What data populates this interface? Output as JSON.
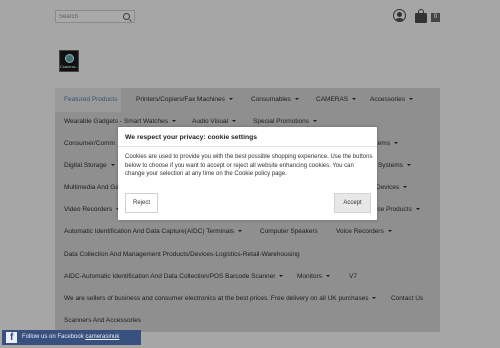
{
  "header": {
    "search_placeholder": "Search",
    "cart_count": "0"
  },
  "logo": {
    "text": "Cameras..."
  },
  "nav": {
    "items": [
      {
        "label": "Featured Products",
        "caret": false
      },
      {
        "label": "Printers/Copiers/Fax Machines",
        "caret": true
      },
      {
        "label": "Consumables",
        "caret": true
      },
      {
        "label": "CAMERAS",
        "caret": true
      },
      {
        "label": "Accessories",
        "caret": true
      },
      {
        "label": "Wearable Gadgets - Smart Watches",
        "caret": true
      },
      {
        "label": "Audio Visual",
        "caret": true
      },
      {
        "label": "Special Promotions",
        "caret": true
      },
      {
        "label": "Consumer/Comm",
        "caret": false
      },
      {
        "label": "tems",
        "caret": true
      },
      {
        "label": "Digital Storage",
        "caret": true
      },
      {
        "label": "r Systems",
        "caret": true
      },
      {
        "label": "Multimedia And Ga",
        "caret": false
      },
      {
        "label": "Devices",
        "caret": true
      },
      {
        "label": "Video Recorders",
        "caret": true
      },
      {
        "label": "rence Products",
        "caret": true
      },
      {
        "label": "Automatic Identification And Data Capture(AIDC) Terminals",
        "caret": true
      },
      {
        "label": "Computer Speakers",
        "caret": false
      },
      {
        "label": "Voice Recorders",
        "caret": true
      },
      {
        "label": "Data Collection And Management Products/Devices-Logistics-Retail-Warehousing",
        "caret": false
      },
      {
        "label": "AIDC-Automatic Identification And Data Collection/POS Barcode Scanner",
        "caret": true
      },
      {
        "label": "Monitors",
        "caret": true
      },
      {
        "label": "V7",
        "caret": false
      },
      {
        "label": "We are sellers of business and consumer electronics at the best prices. Free delivery on all UK purchases",
        "caret": true
      },
      {
        "label": "Contact Us",
        "caret": false
      },
      {
        "label": "Scanners And Accessories",
        "caret": false
      }
    ]
  },
  "cookie_modal": {
    "title": "We respect your privacy: cookie settings",
    "body": "Cookies are used to provide you with the best possible shopping experience. Use the buttons below to choose if you want to accept or reject all website enhancing cookies. You can change your selection at any time on the Cookie policy page.",
    "reject_label": "Reject",
    "accept_label": "Accept"
  },
  "facebook_bar": {
    "text": "Follow us on Facebook",
    "link_text": "camerasinuk"
  },
  "colors": {
    "overlay": "#a6a6a6",
    "nav_background": "#8f8f8f",
    "active_nav": "#3a5276",
    "facebook": "#38507e"
  }
}
